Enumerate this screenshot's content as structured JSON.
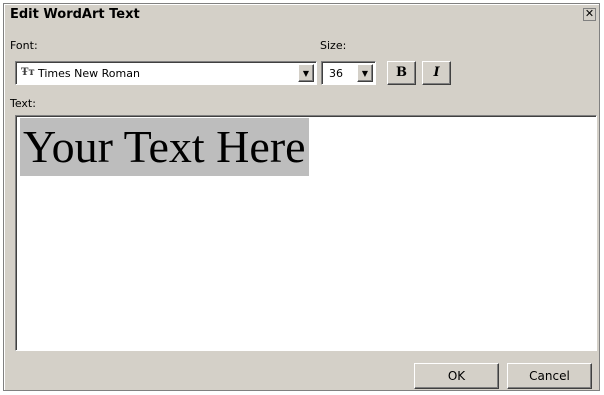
{
  "dialog": {
    "title": "Edit WordArt Text",
    "close_glyph": "✕"
  },
  "font": {
    "label": "Font:",
    "value": "Times New Roman",
    "icon": "truetype-icon",
    "icon_glyph": "Ŧт"
  },
  "size": {
    "label": "Size:",
    "value": "36"
  },
  "format": {
    "bold_label": "B",
    "italic_label": "I"
  },
  "text": {
    "label": "Text:",
    "content": "Your Text Here"
  },
  "buttons": {
    "ok": "OK",
    "cancel": "Cancel"
  },
  "colors": {
    "dialog_bg": "#d4d0c8",
    "selection": "#bdbdbd"
  }
}
